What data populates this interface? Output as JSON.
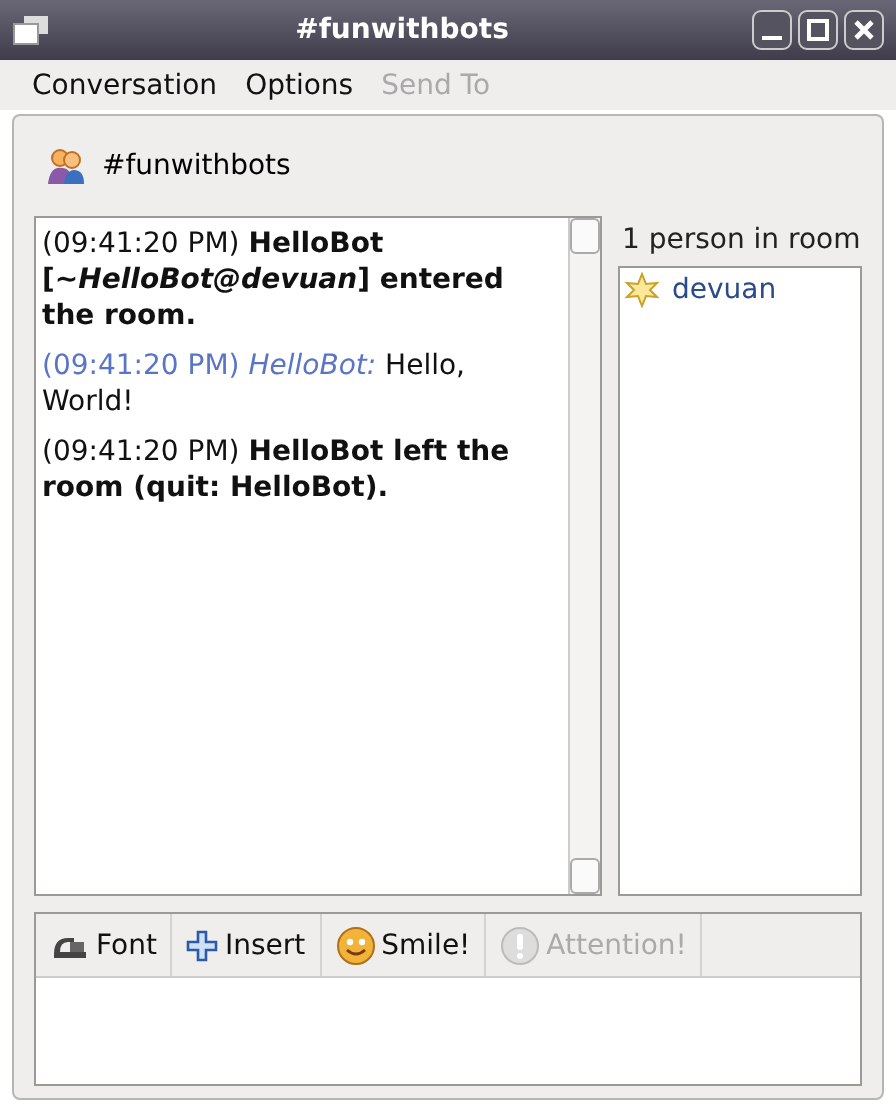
{
  "window": {
    "title": "#funwithbots"
  },
  "menu": [
    {
      "label": "Conversation",
      "disabled": false
    },
    {
      "label": "Options",
      "disabled": false
    },
    {
      "label": "Send To",
      "disabled": true
    }
  ],
  "conversation": {
    "title": "#funwithbots"
  },
  "messages": [
    {
      "kind": "system",
      "time": "(09:41:20 PM)",
      "text": "HelloBot [~*HelloBot@devuan*] entered the room."
    },
    {
      "kind": "chat",
      "time": "(09:41:20 PM)",
      "sender": "HelloBot:",
      "text": "Hello, World!"
    },
    {
      "kind": "system",
      "time": "(09:41:20 PM)",
      "text": "HelloBot left the room (quit: HelloBot)."
    }
  ],
  "users": {
    "count_label": "1 person in room",
    "items": [
      {
        "name": "devuan"
      }
    ]
  },
  "toolbar": [
    {
      "kind": "font",
      "label": "Font",
      "disabled": false
    },
    {
      "kind": "insert",
      "label": "Insert",
      "disabled": false
    },
    {
      "kind": "smile",
      "label": "Smile!",
      "disabled": false
    },
    {
      "kind": "attention",
      "label": "Attention!",
      "disabled": true
    }
  ]
}
